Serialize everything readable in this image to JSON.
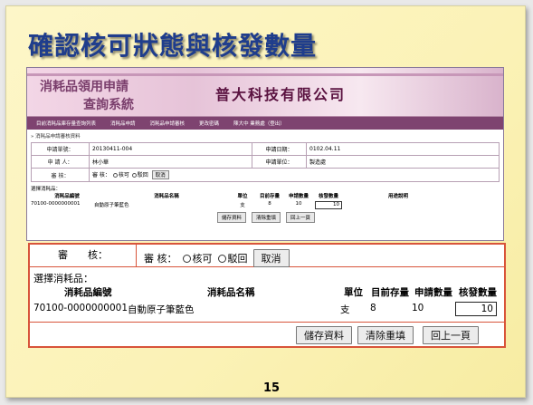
{
  "slide": {
    "title": "確認核可狀態與核發數量",
    "page_number": "15"
  },
  "app": {
    "banner_line1": "消耗品領用申請",
    "banner_line2": "查詢系統",
    "company": "普大科技有限公司",
    "nav": [
      "目前消耗品庫存量查詢列表",
      "消耗品申請",
      "消耗品申請審核",
      "更改密碼",
      "陳大中 業務處（登出）"
    ],
    "breadcrumb": "» 消耗品申請審核資料",
    "form": {
      "app_no_label": "申請單號：",
      "app_no": "20130411-004",
      "date_label": "申請日期：",
      "date": "0102.04.11",
      "applicant_label": "申 請 人：",
      "applicant": "林小華",
      "unit_label": "申請單位：",
      "unit": "製造處",
      "review_label": "審 核：",
      "review_text": "審 核：",
      "approve": "核可",
      "reject": "駁回",
      "cancel": "取消"
    },
    "selected_label": "選擇消耗品：",
    "columns": [
      "消耗品編號",
      "消耗品名稱",
      "單位",
      "目前存量",
      "申請數量",
      "核發數量",
      "用途說明"
    ],
    "item": {
      "code": "70100-0000000001",
      "name": "自動原子筆藍色",
      "unit": "支",
      "stock": "8",
      "requested": "10",
      "issued": "10"
    },
    "buttons": {
      "save": "儲存資料",
      "reset": "清除重填",
      "back": "回上一頁"
    }
  },
  "zoom": {
    "review_label": "審　　核：",
    "review_text": "審 核：",
    "approve": "核可",
    "reject": "駁回",
    "cancel": "取消",
    "selected_label": "選擇消耗品：",
    "columns": [
      "消耗品編號",
      "消耗品名稱",
      "單位",
      "目前存量",
      "申請數量",
      "核發數量"
    ],
    "item": {
      "code": "70100-0000000001",
      "name": "自動原子筆藍色",
      "unit": "支",
      "stock": "8",
      "requested": "10",
      "issued": "10"
    },
    "buttons": {
      "save": "儲存資料",
      "reset": "清除重填",
      "back": "回上一頁"
    }
  }
}
